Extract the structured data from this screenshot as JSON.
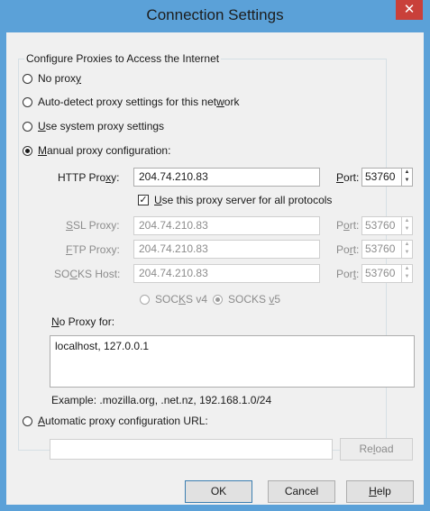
{
  "window": {
    "title": "Connection Settings",
    "close_glyph": "✕"
  },
  "group": {
    "legend": "Configure Proxies to Access the Internet"
  },
  "options": {
    "no_proxy": {
      "label": "No proxy",
      "selected": false
    },
    "auto_detect": {
      "label": "Auto-detect proxy settings for this network",
      "selected": false
    },
    "system": {
      "label": "Use system proxy settings",
      "selected": false
    },
    "manual": {
      "label": "Manual proxy configuration:",
      "selected": true
    },
    "auto_url": {
      "label": "Automatic proxy configuration URL:",
      "selected": false
    }
  },
  "manual": {
    "http": {
      "label": "HTTP Proxy:",
      "value": "204.74.210.83",
      "port_label": "Port:",
      "port": "53760"
    },
    "use_all": {
      "label": "Use this proxy server for all protocols",
      "checked": true
    },
    "ssl": {
      "label": "SSL Proxy:",
      "value": "204.74.210.83",
      "port_label": "Port:",
      "port": "53760"
    },
    "ftp": {
      "label": "FTP Proxy:",
      "value": "204.74.210.83",
      "port_label": "Port:",
      "port": "53760"
    },
    "socks": {
      "label": "SOCKS Host:",
      "value": "204.74.210.83",
      "port_label": "Port:",
      "port": "53760"
    },
    "socks_v4": {
      "label": "SOCKS v4",
      "selected": false
    },
    "socks_v5": {
      "label": "SOCKS v5",
      "selected": true
    }
  },
  "no_proxy_for": {
    "label": "No Proxy for:",
    "value": "localhost, 127.0.0.1",
    "example": "Example: .mozilla.org, .net.nz, 192.168.1.0/24"
  },
  "auto_url": {
    "value": "",
    "reload_label": "Reload"
  },
  "buttons": {
    "ok": "OK",
    "cancel": "Cancel",
    "help": "Help"
  },
  "colors": {
    "titlebar": "#5ba1d8",
    "close": "#c9403a",
    "dialog_bg": "#f0f0f0"
  }
}
